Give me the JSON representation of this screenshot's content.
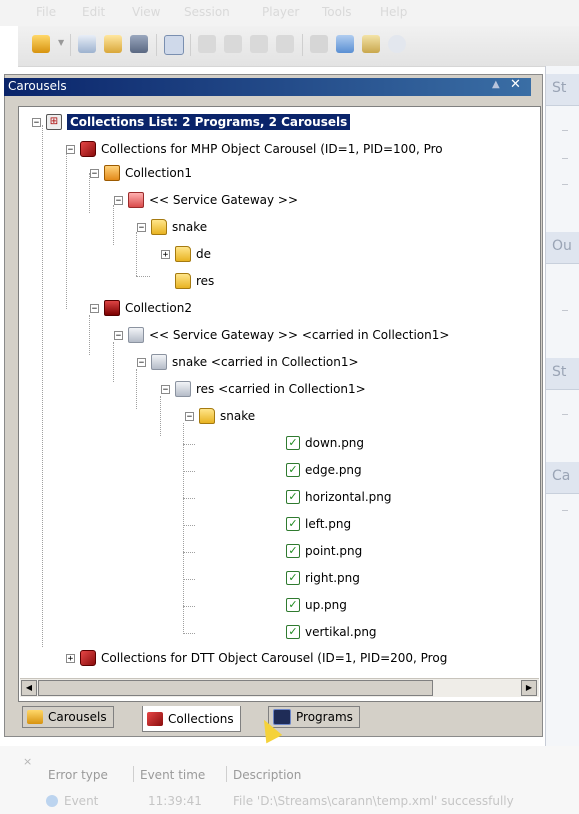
{
  "menu": {
    "items": [
      "File",
      "Edit",
      "View",
      "Session",
      "Player",
      "Tools",
      "Help"
    ]
  },
  "panel": {
    "title": "Carousels",
    "minimize": "▲",
    "close": "✕"
  },
  "right_pane": {
    "headers": [
      "St",
      "Ou",
      "St",
      "Ca"
    ]
  },
  "tree": {
    "root": "Collections List: 2 Programs, 2 Carousels",
    "carousel1": "Collections for MHP Object Carousel (ID=1, PID=100, Pro",
    "collection1": "Collection1",
    "c1_gateway": "<< Service Gateway >>",
    "c1_snake": "snake",
    "c1_de": "de",
    "c1_res": "res",
    "collection2": "Collection2",
    "c2_gateway": "<< Service Gateway >> <carried in Collection1>",
    "c2_snake": "snake <carried in Collection1>",
    "c2_res": "res <carried in Collection1>",
    "c2_snake2": "snake",
    "files": [
      "down.png",
      "edge.png",
      "horizontal.png",
      "left.png",
      "point.png",
      "right.png",
      "up.png",
      "vertikal.png"
    ],
    "carousel2": "Collections for DTT Object Carousel (ID=1, PID=200, Prog"
  },
  "tabs": {
    "carousels": "Carousels",
    "collections": "Collections",
    "programs": "Programs"
  },
  "error_list": {
    "close": "×",
    "columns": [
      "Error type",
      "Event time",
      "Description"
    ],
    "row": {
      "type": "Event",
      "time": "11:39:41",
      "description": "File 'D:\\Streams\\carann\\temp.xml' successfully"
    }
  }
}
